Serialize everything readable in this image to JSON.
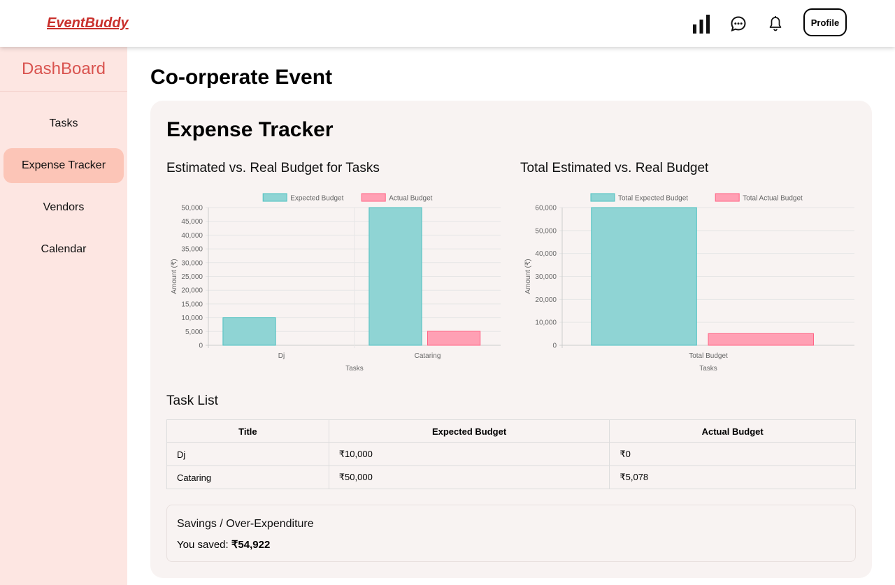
{
  "header": {
    "brand": "EventBuddy",
    "profile_label": "Profile",
    "icons": [
      "bar-chart-icon",
      "chat-icon",
      "bell-icon"
    ]
  },
  "sidebar": {
    "title": "DashBoard",
    "items": [
      {
        "label": "Tasks",
        "active": false
      },
      {
        "label": "Expense Tracker",
        "active": true
      },
      {
        "label": "Vendors",
        "active": false
      },
      {
        "label": "Calendar",
        "active": false
      }
    ]
  },
  "page": {
    "title": "Co-orperate Event",
    "section_title": "Expense Tracker"
  },
  "colors": {
    "expected_fill": "#8fd4d4",
    "expected_stroke": "#4bc0c0",
    "actual_fill": "#ffa0b4",
    "actual_stroke": "#ff6384",
    "accent": "#d9534f",
    "active_nav": "#fcc5b7",
    "sidebar_bg": "#fde6e2"
  },
  "chart_data": [
    {
      "type": "bar",
      "title": "Estimated vs. Real Budget for Tasks",
      "categories": [
        "Dj",
        "Cataring"
      ],
      "series": [
        {
          "name": "Expected Budget",
          "values": [
            10000,
            50000
          ]
        },
        {
          "name": "Actual Budget",
          "values": [
            0,
            5078
          ]
        }
      ],
      "xlabel": "Tasks",
      "ylabel": "Amount (₹)",
      "ylim": [
        0,
        50000
      ],
      "yticks": [
        "0",
        "5,000",
        "10,000",
        "15,000",
        "20,000",
        "25,000",
        "30,000",
        "35,000",
        "40,000",
        "45,000",
        "50,000"
      ],
      "legend": "top",
      "grid": true
    },
    {
      "type": "bar",
      "title": "Total Estimated vs. Real Budget",
      "categories": [
        "Total Budget"
      ],
      "series": [
        {
          "name": "Total Expected Budget",
          "values": [
            60000
          ]
        },
        {
          "name": "Total Actual Budget",
          "values": [
            5078
          ]
        }
      ],
      "xlabel": "Tasks",
      "ylabel": "Amount (₹)",
      "ylim": [
        0,
        60000
      ],
      "yticks": [
        "0",
        "10,000",
        "20,000",
        "30,000",
        "40,000",
        "50,000",
        "60,000"
      ],
      "legend": "top",
      "grid": true
    }
  ],
  "task_list": {
    "title": "Task List",
    "columns": [
      "Title",
      "Expected Budget",
      "Actual Budget"
    ],
    "rows": [
      [
        "Dj",
        "₹10,000",
        "₹0"
      ],
      [
        "Cataring",
        "₹50,000",
        "₹5,078"
      ]
    ]
  },
  "savings": {
    "title": "Savings / Over-Expenditure",
    "label": "You saved:",
    "amount": "₹54,922"
  }
}
